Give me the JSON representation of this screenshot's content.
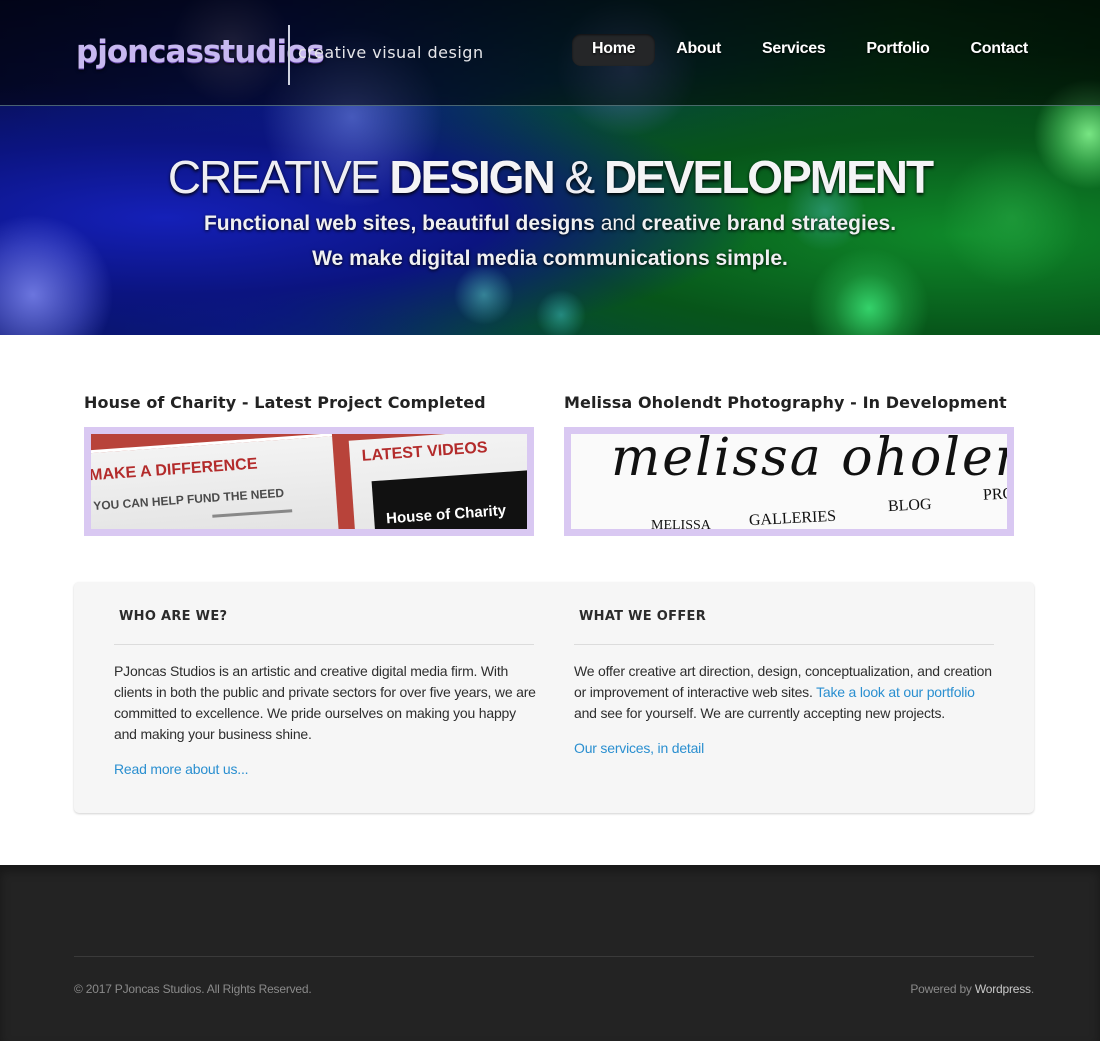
{
  "header": {
    "logo": "pjoncasstudios",
    "tagline": "creative visual design",
    "nav": [
      {
        "label": "Home",
        "active": true
      },
      {
        "label": "About",
        "active": false
      },
      {
        "label": "Services",
        "active": false
      },
      {
        "label": "Portfolio",
        "active": false
      },
      {
        "label": "Contact",
        "active": false
      }
    ]
  },
  "hero": {
    "title_light": "CREATIVE ",
    "title_bold": "DESIGN",
    "title_amp": " & ",
    "title_bold2": "DEVELOPMENT",
    "sub1_a": "Functional web sites, beautiful designs",
    "sub1_b": " and ",
    "sub1_c": "creative brand strategies.",
    "sub2": "We make digital media communications simple."
  },
  "projects": [
    {
      "title": "House of Charity - Latest Project Completed",
      "thumb": {
        "make": "MAKE A DIFFERENCE",
        "fund": "YOU CAN HELP FUND THE NEED",
        "latest": "LATEST VIDEOS",
        "hof": "House of Charity"
      }
    },
    {
      "title": "Melissa Oholendt Photography - In Development",
      "thumb": {
        "script": "melissa oholendt",
        "menu_1": "MELISSA",
        "menu_2": "GALLERIES",
        "menu_3": "BLOG",
        "menu_4": "PRO"
      }
    }
  ],
  "info": {
    "who": {
      "heading": "WHO ARE WE?",
      "body": "PJoncas Studios is an artistic and creative digital media firm. With clients in both the public and private sectors for over five years, we are committed to excellence. We pride ourselves on making you happy and making your business shine.",
      "link": "Read more about us..."
    },
    "offer": {
      "heading": "WHAT WE OFFER",
      "body_a": "We offer creative art direction, design, conceptualization, and creation or improvement of interactive web sites. ",
      "body_link": "Take a look at our portfolio",
      "body_b": " and see for yourself. We are currently accepting new projects.",
      "link": "Our services, in detail"
    }
  },
  "footer": {
    "copyright": "© 2017 PJoncas Studios. All Rights Reserved.",
    "powered_prefix": "Powered by ",
    "powered_link": "Wordpress",
    "powered_suffix": "."
  },
  "colors": {
    "accent_link": "#2a8fd0",
    "thumb_frame": "#d9c8f2",
    "footer_bg": "#232323",
    "info_bg": "#f6f6f6"
  }
}
